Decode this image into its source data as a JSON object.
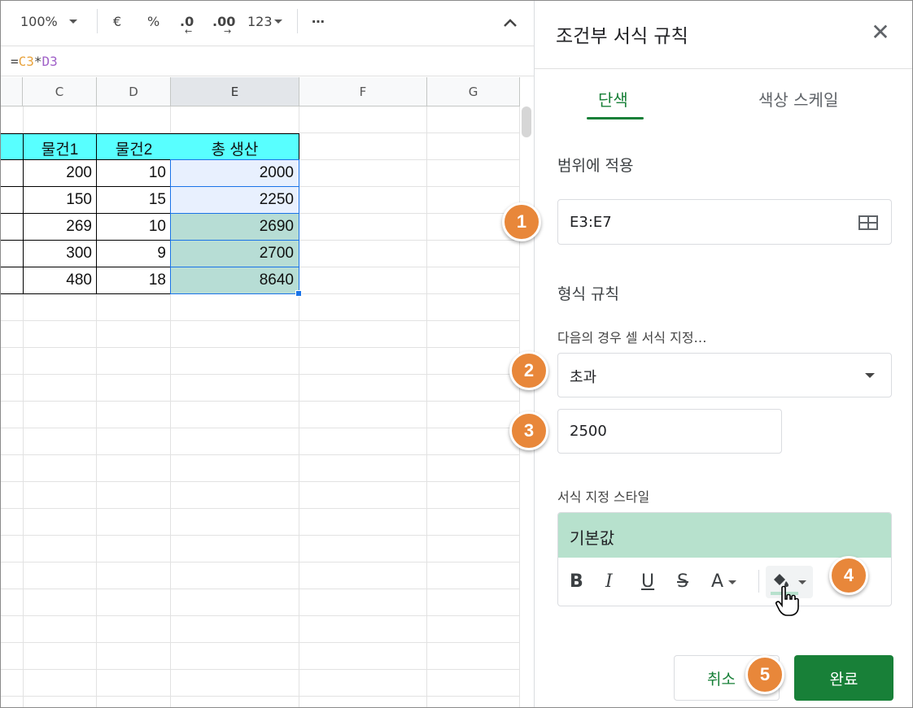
{
  "toolbar": {
    "zoom": "100%",
    "currency": "€",
    "percent": "%",
    "decrease_decimal": ".0",
    "decrease_decimal_arrow": "←",
    "increase_decimal": ".00",
    "increase_decimal_arrow": "→",
    "number_format": "123",
    "more": "⋯",
    "collapse": "^"
  },
  "formula_bar": {
    "eq": "=",
    "ref1": "C3",
    "op": "*",
    "ref2": "D3"
  },
  "columns": [
    "C",
    "D",
    "E",
    "F",
    "G"
  ],
  "table": {
    "headers": [
      "물건1",
      "물건2",
      "총 생산"
    ],
    "rows": [
      [
        "200",
        "10",
        "2000"
      ],
      [
        "150",
        "15",
        "2250"
      ],
      [
        "269",
        "10",
        "2690"
      ],
      [
        "300",
        "9",
        "2700"
      ],
      [
        "480",
        "18",
        "8640"
      ]
    ]
  },
  "panel": {
    "title": "조건부 서식 규칙",
    "close_icon": "✕",
    "tabs": [
      "단색",
      "색상 스케일"
    ],
    "apply_range_label": "범위에 적용",
    "range_value": "E3:E7",
    "format_rules_label": "형식 규칙",
    "condition_label": "다음의 경우 셀 서식 지정…",
    "condition_value": "초과",
    "threshold_value": "2500",
    "style_label": "서식 지정 스타일",
    "style_preview": "기본값",
    "style_buttons": {
      "bold": "B",
      "italic": "I",
      "underline": "U",
      "strike": "S",
      "text_color": "A"
    },
    "cancel_label": "취소",
    "done_label": "완료"
  },
  "badges": [
    "1",
    "2",
    "3",
    "4",
    "5"
  ],
  "colors": {
    "accent": "#188038",
    "header_fill": "#58ffff",
    "highlight_fill": "#b7ddd5",
    "style_preview_fill": "#b7e1cd",
    "badge": "#e8873a"
  }
}
